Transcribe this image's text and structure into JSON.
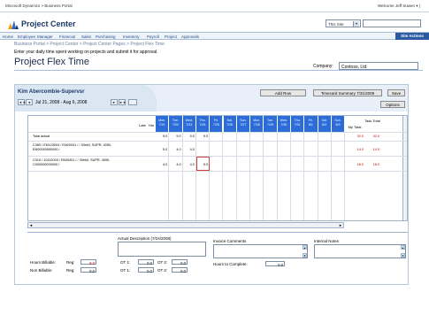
{
  "topbar": {
    "brand": "Microsoft Dynamics > Business Portal",
    "welcome": "Welcome Jeff Suwen ▾ |"
  },
  "header": {
    "site_title": "Project Center",
    "search_scope": "This Site",
    "search_dd": "▾"
  },
  "nav": {
    "items": [
      "Home",
      "Employee",
      "Manager",
      "Financial",
      "Sales",
      "Purchasing",
      "Inventory",
      "Payroll",
      "Project",
      "Approvals"
    ],
    "site_actions": "Site Actions"
  },
  "breadcrumb": "Business Portal > Project Center > Project Center Pages > Project Flex Time",
  "description": "Enter your daily time spent working on projects and submit it for approval.",
  "page_title": "Project Flex Time",
  "company": {
    "label": "Company:",
    "value": "Contoso, Ltd"
  },
  "timesheet": {
    "worker": "Kim Abercombie-Supervsr",
    "period": "Jul 21, 2008 - Aug 6, 2008",
    "nav_prev": "◄◄ ◄",
    "nav_next": "► ►►",
    "nav_first": "◄◄",
    "nav_back": "◄",
    "nav_fwd": "►",
    "nav_last": "►►",
    "buttons": {
      "add_row": "Add Row",
      "summary": "Timecard Summary 7/31/2008",
      "save": "Save",
      "options": "Options"
    },
    "col_late": "Late",
    "col_hrs": "Hrs",
    "days": [
      {
        "dow": "Mon.",
        "date": "7/21"
      },
      {
        "dow": "Tue.",
        "date": "7/22"
      },
      {
        "dow": "Wed.",
        "date": "7/23"
      },
      {
        "dow": "Thu.",
        "date": "7/24"
      },
      {
        "dow": "Fri.",
        "date": "7/25"
      },
      {
        "dow": "Sat.",
        "date": "7/26"
      },
      {
        "dow": "Sun.",
        "date": "7/27"
      },
      {
        "dow": "Mon.",
        "date": "7/28"
      },
      {
        "dow": "Tue.",
        "date": "7/29"
      },
      {
        "dow": "Wed.",
        "date": "7/30"
      },
      {
        "dow": "Thu.",
        "date": "7/31"
      },
      {
        "dow": "Fri.",
        "date": "8/1"
      },
      {
        "dow": "Sat.",
        "date": "8/2"
      },
      {
        "dow": "Sun.",
        "date": "8/3"
      }
    ],
    "col_my_total": "My Total",
    "col_task_total": "Task Total",
    "total_actual_label": "Total actual",
    "total_actual": [
      "9.0",
      "9.0",
      "9.0",
      "9.0",
      "",
      "",
      "",
      "",
      "",
      "",
      "",
      "",
      "",
      ""
    ],
    "total_my": "32.0",
    "total_task": "32.0",
    "rows": [
      {
        "desc": "C369 / EN123004 / EN00031 / / 30ek0, SUPR, 4050, EN00000000000 /",
        "values": [
          "5.0",
          "4.0",
          "4.0",
          "",
          "",
          "",
          "",
          "",
          "",
          "",
          "",
          "",
          "",
          ""
        ],
        "my_total": "14.0",
        "task_total": "14.0"
      },
      {
        "desc": "C310 / 10112003 / PA00401 / / 30ek0, SUPR, 4050, C000000000000 /",
        "values": [
          "4.0",
          "4.0",
          "4.0",
          "9.0",
          "",
          "",
          "",
          "",
          "",
          "",
          "",
          "",
          "",
          ""
        ],
        "my_total": "18.0",
        "task_total": "18.0"
      }
    ]
  },
  "details": {
    "actual_desc_label": "Actual Description (7/24/2008)",
    "invoice_label": "Invoice Comments",
    "internal_label": "Internal Notes",
    "hours_billable": "Hours Billable:",
    "non_billable": "Non Billable:",
    "reg": "Reg:",
    "ot1": "OT 1:",
    "ot2": "OT 2:",
    "hours_to_complete": "Hours to Complete:",
    "billable_reg": "9.0",
    "billable_ot1": "0.0",
    "billable_ot2": "0.0",
    "nonbill_reg": "0.0",
    "nonbill_ot1": "0.0",
    "nonbill_ot2": "0.0",
    "complete_val": "0.0"
  }
}
